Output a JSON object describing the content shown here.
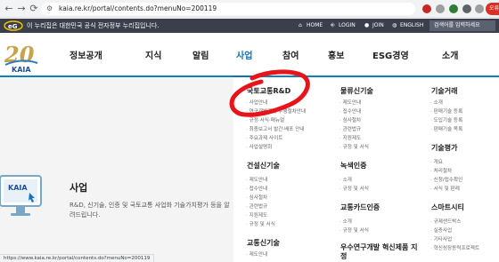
{
  "browser": {
    "url": "kaia.re.kr/portal/contents.do?menuNo=200119",
    "profile_label": "오류"
  },
  "topbar": {
    "gov_notice": "이 누리집은 대한민국 공식 전자정부 누리집입니다.",
    "home": "HOME",
    "login": "LOGIN",
    "join": "JOIN",
    "english": "ENGLISH",
    "search_placeholder": "검색어를 입력하세요"
  },
  "logo": {
    "text": "KAIA",
    "number": "20"
  },
  "gnb": [
    "정보공개",
    "지식",
    "알림",
    "사업",
    "참여",
    "홍보",
    "ESG경영",
    "소개"
  ],
  "section": {
    "icon_label": "KAIA",
    "title": "사업",
    "description": "R&D, 신기술, 인증 및 국토교통 사업화 기술가치평가 등을 알려드립니다."
  },
  "menu": {
    "col1": {
      "groups": [
        {
          "title": "국토교통R&D",
          "items": [
            "사업안내",
            "연구개발과제 수행절차안내",
            "규정·서식·매뉴얼",
            "최종보고서 발간·배포 안내",
            "주요과제 사이트",
            "사업설명회"
          ]
        },
        {
          "title": "건설신기술",
          "items": [
            "제도안내",
            "접수안내",
            "심사절차",
            "관련법규",
            "지원제도",
            "규정 및 서식"
          ]
        },
        {
          "title": "교통신기술",
          "items": [
            "제도안내"
          ]
        }
      ]
    },
    "col2": {
      "groups": [
        {
          "title": "물류신기술",
          "items": [
            "제도안내",
            "접수안내",
            "심사절차",
            "관련법규",
            "지원제도",
            "규정 및 서식"
          ]
        },
        {
          "title": "녹색인증",
          "items": [
            "소개",
            "규정 및 서식"
          ]
        },
        {
          "title": "교통카드인증",
          "items": [
            "소개",
            "규정 및 서식"
          ]
        },
        {
          "title": "우수연구개발 혁신제품 지정",
          "items": []
        }
      ]
    },
    "col3": {
      "groups": [
        {
          "title": "기술거래",
          "items": [
            "소개",
            "판매기술 등록",
            "도입기술 등록",
            "판매기술 목록"
          ]
        },
        {
          "title": "기술평가",
          "items": [
            "개요",
            "처리절차",
            "신청/접수확인",
            "서식 및 판례"
          ]
        },
        {
          "title": "스마트시티",
          "items": [
            "규제샌드박스",
            "실증사업",
            "기타사업",
            "혁신성장동력프로젝트"
          ]
        }
      ]
    }
  },
  "statusbar": "https://www.kaia.re.kr/portal/contents.do?menuNo=200119",
  "colors": {
    "accent": "#0e6eb8",
    "annotation": "#e8141a",
    "topbar": "#3a3f4b"
  }
}
